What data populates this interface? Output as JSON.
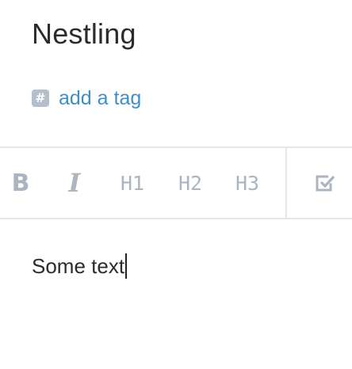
{
  "note": {
    "title": "Nestling"
  },
  "tags": {
    "icon": "hash-icon",
    "icon_glyph": "#",
    "add_label": "add a tag"
  },
  "toolbar": {
    "bold_label": "B",
    "italic_label": "I",
    "h1_label": "H1",
    "h2_label": "H2",
    "h3_label": "H3",
    "checklist_icon": "checkbox-icon"
  },
  "editor": {
    "content": "Some text"
  },
  "colors": {
    "link": "#3f8fc7",
    "toolbar_icon": "#aab5c0",
    "divider": "#e4e8ec",
    "text": "#2b2b2b"
  }
}
